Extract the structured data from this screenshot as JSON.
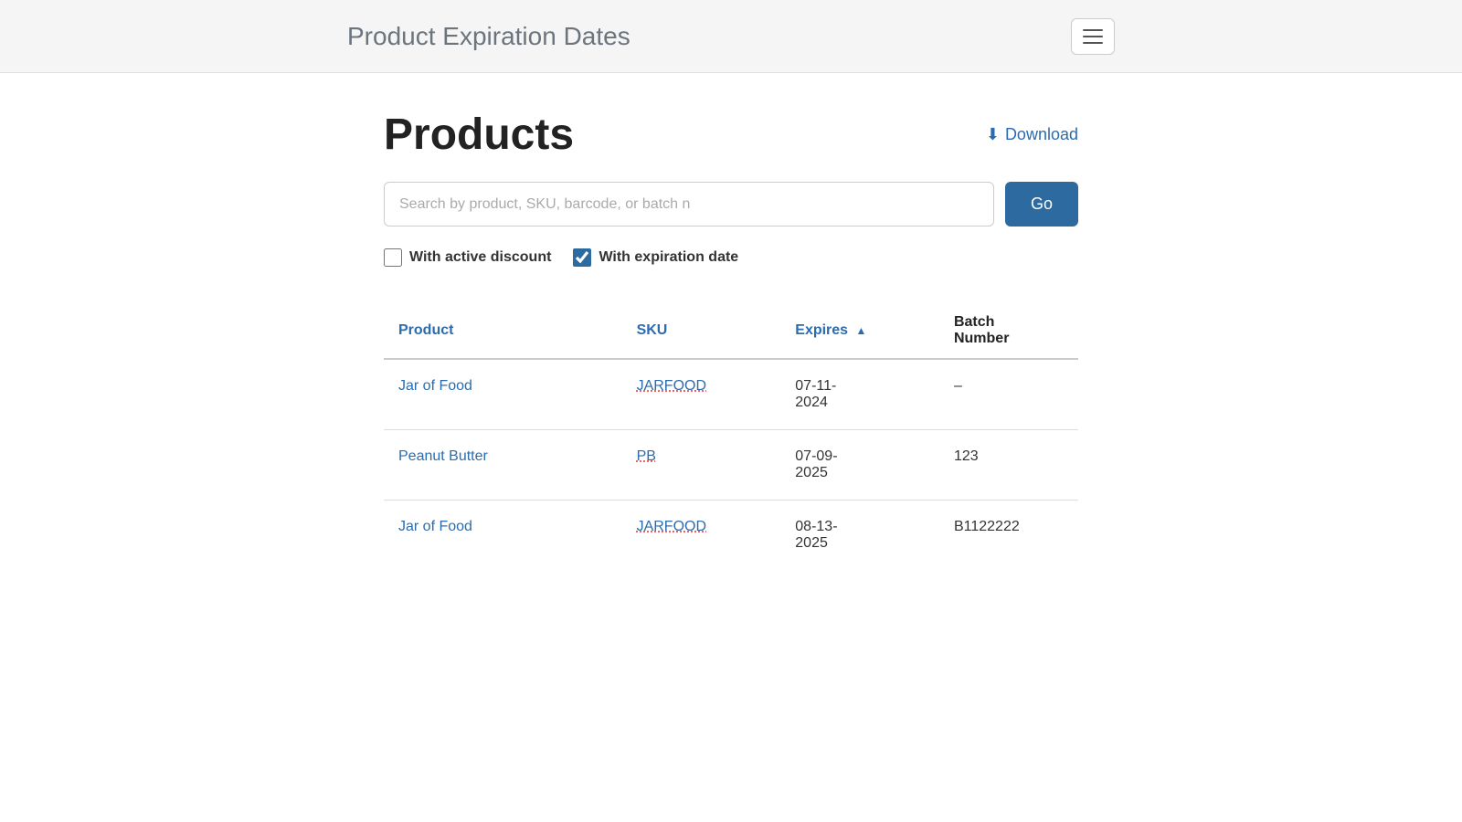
{
  "navbar": {
    "title": "Product Expiration Dates",
    "toggle_label": "Toggle navigation"
  },
  "page": {
    "heading": "Products",
    "download_label": "Download",
    "download_icon": "⬇",
    "search": {
      "placeholder": "Search by product, SKU, barcode, or batch n",
      "go_label": "Go"
    },
    "filters": [
      {
        "id": "active-discount",
        "label": "With active discount",
        "checked": false
      },
      {
        "id": "expiration-date",
        "label": "With expiration date",
        "checked": true
      }
    ],
    "table": {
      "columns": [
        {
          "key": "product",
          "label": "Product",
          "sortable": false
        },
        {
          "key": "sku",
          "label": "SKU",
          "sortable": false
        },
        {
          "key": "expires",
          "label": "Expires",
          "sortable": true,
          "sort_dir": "asc"
        },
        {
          "key": "batch",
          "label": "Batch Number",
          "sortable": false
        }
      ],
      "rows": [
        {
          "product": "Jar of Food",
          "sku": "JARFOOD",
          "expires": "07-11-2024",
          "batch": "–"
        },
        {
          "product": "Peanut Butter",
          "sku": "PB",
          "expires": "07-09-2025",
          "batch": "123"
        },
        {
          "product": "Jar of Food",
          "sku": "JARFOOD",
          "expires": "08-13-2025",
          "batch": "B1122222"
        }
      ]
    }
  }
}
